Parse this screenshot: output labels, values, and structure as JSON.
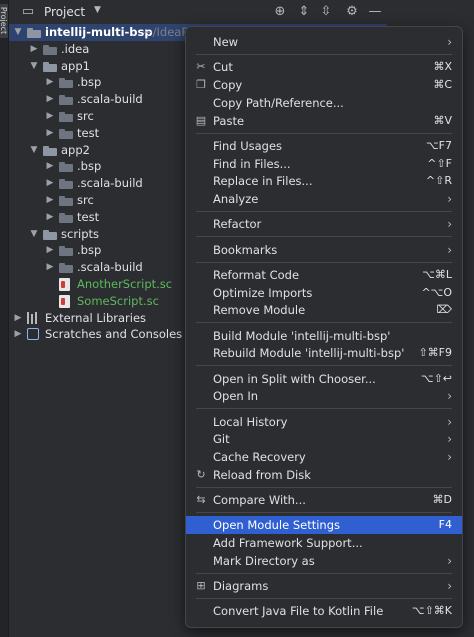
{
  "side_panel": {
    "tab_label": "Project"
  },
  "toolbar": {
    "title": "Project",
    "icons": [
      "project-icon",
      "chevron-down-icon",
      "locate-icon",
      "expand-all-icon",
      "collapse-all-icon",
      "gear-icon",
      "minimize-icon"
    ]
  },
  "tree": [
    {
      "label": "intellij-multi-bsp",
      "suffix": "~/IdeaPr",
      "level": 0,
      "arrow": "down",
      "icon": "folder",
      "style": "bold"
    },
    {
      "label": ".idea",
      "level": 1,
      "arrow": "right",
      "icon": "folder"
    },
    {
      "label": "app1",
      "level": 1,
      "arrow": "down",
      "icon": "folder"
    },
    {
      "label": ".bsp",
      "level": 2,
      "arrow": "right",
      "icon": "folder"
    },
    {
      "label": ".scala-build",
      "level": 2,
      "arrow": "right",
      "icon": "folder"
    },
    {
      "label": "src",
      "level": 2,
      "arrow": "right",
      "icon": "folder"
    },
    {
      "label": "test",
      "level": 2,
      "arrow": "right",
      "icon": "folder"
    },
    {
      "label": "app2",
      "level": 1,
      "arrow": "down",
      "icon": "folder"
    },
    {
      "label": ".bsp",
      "level": 2,
      "arrow": "right",
      "icon": "folder"
    },
    {
      "label": ".scala-build",
      "level": 2,
      "arrow": "right",
      "icon": "folder"
    },
    {
      "label": "src",
      "level": 2,
      "arrow": "right",
      "icon": "folder"
    },
    {
      "label": "test",
      "level": 2,
      "arrow": "right",
      "icon": "folder"
    },
    {
      "label": "scripts",
      "level": 1,
      "arrow": "down",
      "icon": "folder"
    },
    {
      "label": ".bsp",
      "level": 2,
      "arrow": "right",
      "icon": "folder"
    },
    {
      "label": ".scala-build",
      "level": 2,
      "arrow": "right",
      "icon": "folder"
    },
    {
      "label": "AnotherScript.sc",
      "level": 2,
      "arrow": "",
      "icon": "scala-file",
      "style": "green"
    },
    {
      "label": "SomeScript.sc",
      "level": 2,
      "arrow": "",
      "icon": "scala-file",
      "style": "green"
    },
    {
      "label": "External Libraries",
      "level": 0,
      "arrow": "right",
      "icon": "library"
    },
    {
      "label": "Scratches and Consoles",
      "level": 0,
      "arrow": "right",
      "icon": "scratch"
    }
  ],
  "context_menu": {
    "groups": [
      [
        {
          "label": "New",
          "submenu": true
        }
      ],
      [
        {
          "label": "Cut",
          "icon": "cut-icon",
          "glyph": "✂",
          "shortcut": "⌘X"
        },
        {
          "label": "Copy",
          "icon": "copy-icon",
          "glyph": "❐",
          "shortcut": "⌘C"
        },
        {
          "label": "Copy Path/Reference..."
        },
        {
          "label": "Paste",
          "icon": "paste-icon",
          "glyph": "▤",
          "shortcut": "⌘V"
        }
      ],
      [
        {
          "label": "Find Usages",
          "shortcut": "⌥F7"
        },
        {
          "label": "Find in Files...",
          "shortcut": "^⇧F"
        },
        {
          "label": "Replace in Files...",
          "shortcut": "^⇧R"
        },
        {
          "label": "Analyze",
          "submenu": true
        }
      ],
      [
        {
          "label": "Refactor",
          "submenu": true
        }
      ],
      [
        {
          "label": "Bookmarks",
          "submenu": true
        }
      ],
      [
        {
          "label": "Reformat Code",
          "shortcut": "⌥⌘L"
        },
        {
          "label": "Optimize Imports",
          "shortcut": "^⌥O"
        },
        {
          "label": "Remove Module",
          "shortcut": "⌦"
        }
      ],
      [
        {
          "label": "Build Module 'intellij-multi-bsp'"
        },
        {
          "label": "Rebuild Module 'intellij-multi-bsp'",
          "shortcut": "⇧⌘F9"
        }
      ],
      [
        {
          "label": "Open in Split with Chooser...",
          "shortcut": "⌥⇧↩"
        },
        {
          "label": "Open In",
          "submenu": true
        }
      ],
      [
        {
          "label": "Local History",
          "submenu": true
        },
        {
          "label": "Git",
          "submenu": true
        },
        {
          "label": "Cache Recovery",
          "submenu": true
        },
        {
          "label": "Reload from Disk",
          "icon": "reload-icon",
          "glyph": "↻"
        }
      ],
      [
        {
          "label": "Compare With...",
          "icon": "compare-icon",
          "glyph": "⇆",
          "shortcut": "⌘D"
        }
      ],
      [
        {
          "label": "Open Module Settings",
          "shortcut": "F4",
          "highlighted": true
        },
        {
          "label": "Add Framework Support..."
        },
        {
          "label": "Mark Directory as",
          "submenu": true
        }
      ],
      [
        {
          "label": "Diagrams",
          "icon": "diagram-icon",
          "glyph": "⊞",
          "submenu": true
        }
      ],
      [
        {
          "label": "Convert Java File to Kotlin File",
          "shortcut": "⌥⇧⌘K"
        }
      ]
    ]
  },
  "colors": {
    "background": "#2b2d30",
    "selection": "#2e436e",
    "menu_highlight": "#2f5fd0",
    "script_file": "#5fb85f"
  }
}
